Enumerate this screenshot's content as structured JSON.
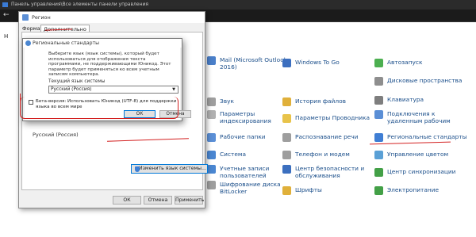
{
  "control_panel": {
    "title": "Панель управления\\Все элементы панели управления",
    "nav_char": "Н",
    "items": [
      {
        "label": "Mail (Microsoft Outlook 2016)",
        "l1": "Mail (Microsoft Outlook",
        "l2": "2016)",
        "color": "#4a7fc9"
      },
      {
        "label": "Windows To Go",
        "color": "#3c6fbf"
      },
      {
        "label": "Автозапуск",
        "color": "#4caf50"
      },
      {
        "label": "Дисковые пространства",
        "color": "#8e8e8e"
      },
      {
        "label": "Звук",
        "color": "#9e9e9e"
      },
      {
        "label": "История файлов",
        "color": "#e0b03a"
      },
      {
        "label": "Клавиатура",
        "color": "#7e7e7e"
      },
      {
        "label": "Параметры индексирования",
        "l1": "Параметры",
        "l2": "индексирования",
        "color": "#b0b0b0"
      },
      {
        "label": "Параметры Проводника",
        "color": "#e8c34a"
      },
      {
        "label": "Подключения к удаленным рабочим",
        "l1": "Подключения к",
        "l2": "удаленным рабочим",
        "color": "#5b8fd6"
      },
      {
        "label": "Рабочие папки",
        "color": "#5b8fd6"
      },
      {
        "label": "Распознавание речи",
        "color": "#9e9e9e"
      },
      {
        "label": "Региональные стандарты",
        "color": "#3f7ed4"
      },
      {
        "label": "Система",
        "color": "#4a86d1"
      },
      {
        "label": "Телефон и модем",
        "color": "#9e9e9e"
      },
      {
        "label": "Управление цветом",
        "color": "#5aa0d6"
      },
      {
        "label": "Учетные записи пользователей",
        "l1": "Учетные записи",
        "l2": "пользователей",
        "color": "#4a86d1"
      },
      {
        "label": "Центр безопасности и обслуживания",
        "l1": "Центр безопасности и",
        "l2": "обслуживания",
        "color": "#3c6fbf"
      },
      {
        "label": "Центр синхронизации",
        "color": "#43a047"
      },
      {
        "label": "Шифрование диска BitLocker",
        "l1": "Шифрование диска",
        "l2": "BitLocker",
        "color": "#9e9e9e"
      },
      {
        "label": "Шрифты",
        "color": "#e0b03a"
      },
      {
        "label": "Электропитание",
        "color": "#43a047"
      }
    ]
  },
  "region_window": {
    "title": "Регион",
    "tabs": [
      "Форматы",
      "Дополнительно"
    ],
    "current_lang_text": "Русский (Россия)",
    "change_lang_button": "Изменить язык системы...",
    "buttons": [
      "ОК",
      "Отмена",
      "Применить"
    ]
  },
  "standards_dialog": {
    "title": "Региональные стандарты",
    "description": "Выберите язык (язык системы), который будет использоваться для отображения текста программами, не поддерживающими Юникод. Этот параметр будет применяться ко всем учетным записям компьютера.",
    "current_lang_label": "Текущий язык системы",
    "selected_lang": "Русский (Россия)",
    "beta_checkbox_label": "Бета-версия: Использовать Юникод (UTF-8) для поддержки языка во всем мире",
    "beta_checked": false,
    "ok": "ОК",
    "cancel": "Отмена"
  },
  "colors": {
    "annotation_red": "#d32020",
    "accent_blue": "#0078d7"
  }
}
